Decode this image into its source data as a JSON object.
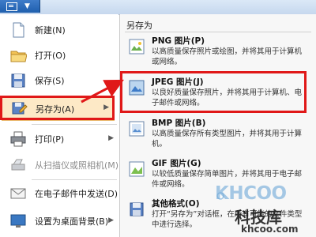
{
  "left_menu": {
    "items": [
      {
        "label": "新建(N)",
        "icon": "new-file-icon"
      },
      {
        "label": "打开(O)",
        "icon": "open-folder-icon"
      },
      {
        "label": "保存(S)",
        "icon": "save-disk-icon"
      },
      {
        "label": "另存为(A)",
        "icon": "save-as-icon"
      },
      {
        "label": "打印(P)",
        "icon": "printer-icon"
      },
      {
        "label": "从扫描仪或照相机(M)",
        "icon": "scanner-icon"
      },
      {
        "label": "在电子邮件中发送(D)",
        "icon": "email-icon"
      },
      {
        "label": "设置为桌面背景(B)",
        "icon": "desktop-background-icon"
      }
    ]
  },
  "right_pane": {
    "title": "另存为",
    "options": [
      {
        "title": "PNG 图片(P)",
        "desc": "以高质量保存照片或绘图，并将其用于计算机或网络。",
        "icon": "png-icon"
      },
      {
        "title": "JPEG 图片(J)",
        "desc": "以良好质量保存照片，并将其用于计算机、电子邮件或网络。",
        "icon": "jpeg-icon"
      },
      {
        "title": "BMP 图片(B)",
        "desc": "以高质量保存所有类型图片，并将其用于计算机。",
        "icon": "bmp-icon"
      },
      {
        "title": "GIF 图片(G)",
        "desc": "以较低质量保存简单图片，并将其用于电子邮件或网络。",
        "icon": "gif-icon"
      },
      {
        "title": "其他格式(O)",
        "desc": "打开“另存为”对话框，在所有可能的文件类型中进行选择。",
        "icon": "other-formats-icon"
      }
    ]
  },
  "watermark": {
    "brand": "KHCOO",
    "site_cn": "科技库",
    "url": "khcoo.com"
  },
  "colors": {
    "highlight": "#e01818",
    "titlebar": "#1f5fae"
  }
}
